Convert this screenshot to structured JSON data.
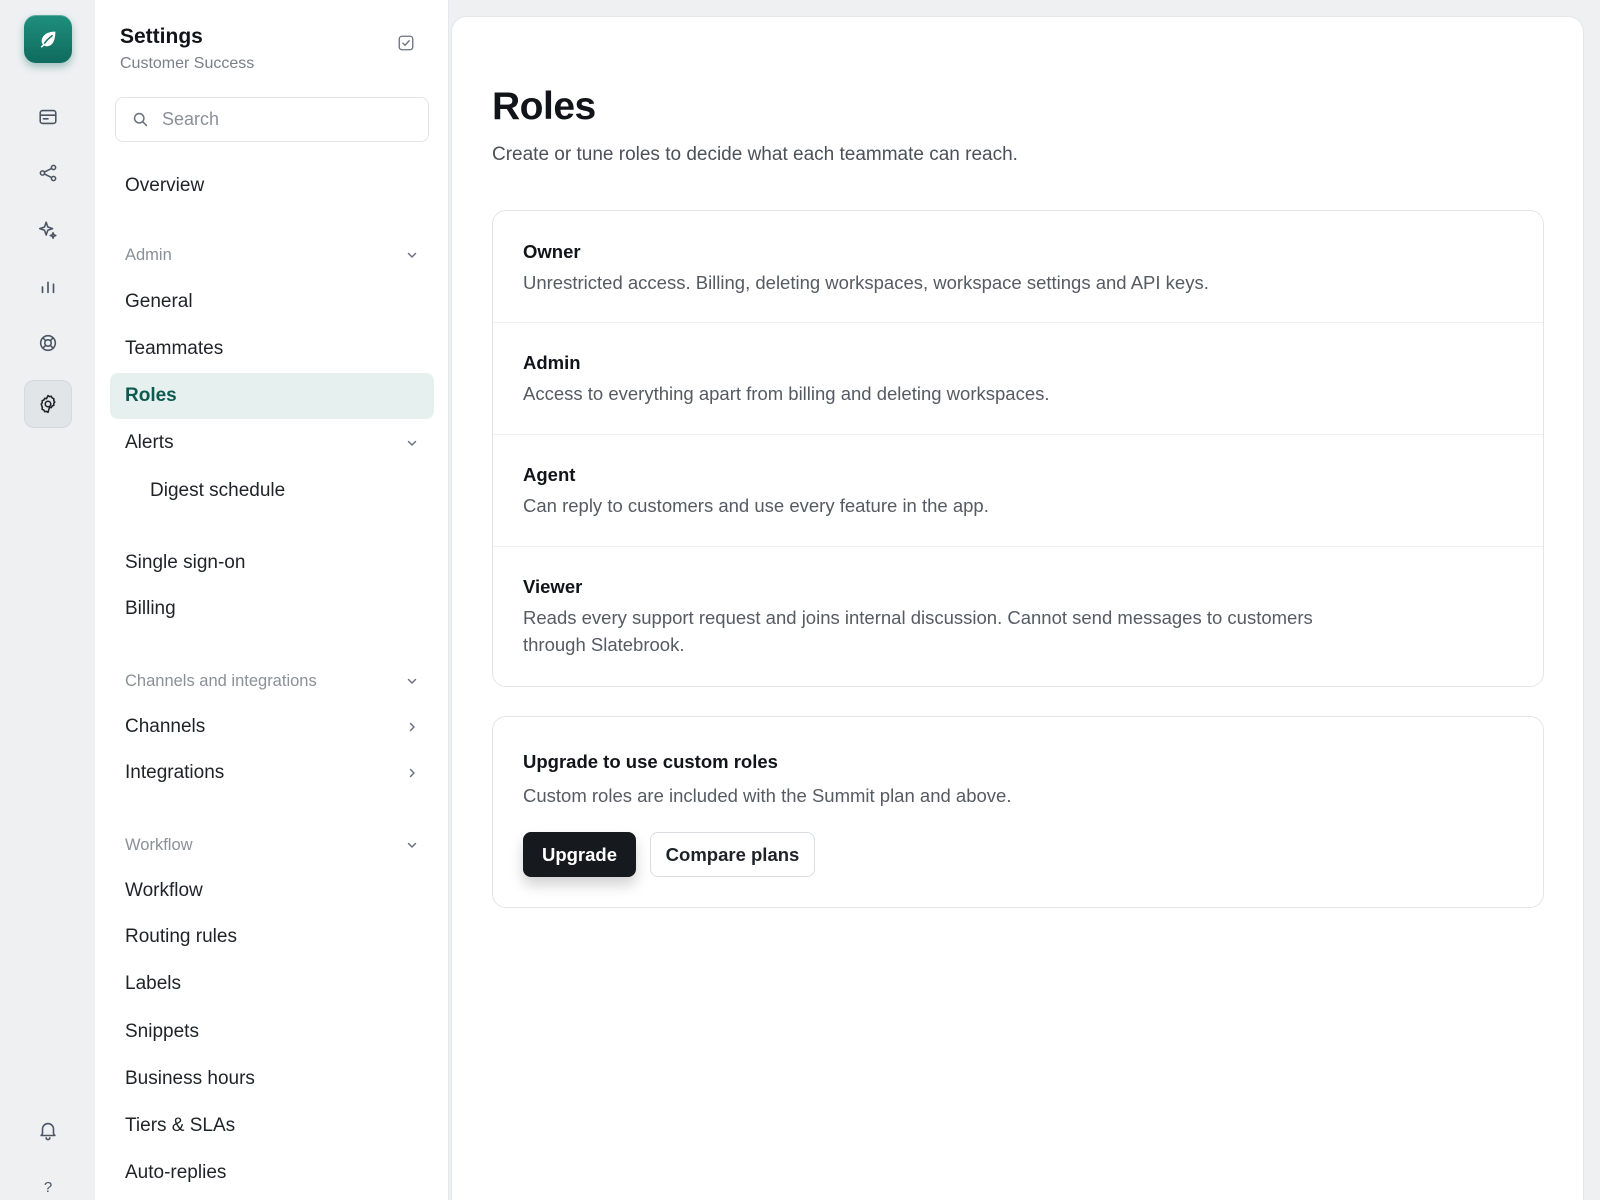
{
  "rail": {
    "icons": [
      "inbox-icon",
      "share-icon",
      "sparkle-icon",
      "chart-icon",
      "lifebuoy-icon",
      "settings-icon"
    ],
    "bottom": {
      "bell": "bell-icon",
      "help_label": "?"
    },
    "brand_color": "#137a6b"
  },
  "sidebar": {
    "title": "Settings",
    "subtitle": "Customer Success",
    "search": {
      "placeholder": "Search"
    },
    "overview": "Overview",
    "sections": {
      "admin": "Admin",
      "channels": "Channels and integrations",
      "workflow": "Workflow"
    },
    "items": {
      "general": "General",
      "teammates": "Teammates",
      "roles": "Roles",
      "alerts": "Alerts",
      "digest": "Digest schedule",
      "sso": "Single sign-on",
      "billing": "Billing",
      "channels": "Channels",
      "integrations": "Integrations",
      "workflow": "Workflow",
      "routing": "Routing rules",
      "labels": "Labels",
      "snippets": "Snippets",
      "hours": "Business hours",
      "tiers": "Tiers & SLAs",
      "autoreplies": "Auto-replies"
    },
    "active_item": "Roles",
    "active_bg": "#e6f1ef",
    "active_text": "#0e5a50"
  },
  "main": {
    "title": "Roles",
    "description": "Create or tune roles to decide what each teammate can reach.",
    "roles": [
      {
        "name": "Owner",
        "description": "Unrestricted access. Billing, deleting workspaces, workspace settings and API keys."
      },
      {
        "name": "Admin",
        "description": "Access to everything apart from billing and deleting workspaces."
      },
      {
        "name": "Agent",
        "description": "Can reply to customers and use every feature in the app."
      },
      {
        "name": "Viewer",
        "description": "Reads every support request and joins internal discussion. Cannot send messages to customers through Slatebrook."
      }
    ],
    "upgrade": {
      "title": "Upgrade to use custom roles",
      "description": "Custom roles are included with the Summit plan and above.",
      "primary_label": "Upgrade",
      "secondary_label": "Compare plans"
    }
  }
}
